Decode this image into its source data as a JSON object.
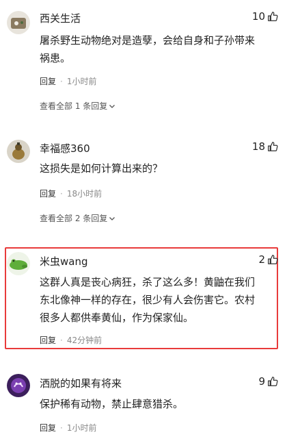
{
  "comments": [
    {
      "username": "西关生活",
      "likes": "10",
      "text": "屠杀野生动物绝对是造孽，会给自身和子孙带来\n祸患。",
      "reply_label": "回复",
      "time": "1小时前",
      "view_replies": "查看全部 1 条回复"
    },
    {
      "username": "幸福感360",
      "likes": "18",
      "text": "这损失是如何计算出来的？",
      "reply_label": "回复",
      "time": "18小时前",
      "view_replies": "查看全部 2 条回复"
    },
    {
      "username": "米虫wang",
      "likes": "2",
      "text": "这群人真是丧心病狂，杀了这么多！黄鼬在我们\n东北像神一样的存在，很少有人会伤害它。农村\n很多人都供奉黄仙，作为保家仙。",
      "reply_label": "回复",
      "time": "42分钟前"
    },
    {
      "username": "洒脱的如果有将来",
      "likes": "9",
      "text": "保护稀有动物，禁止肆意猎杀。",
      "reply_label": "回复",
      "time": "1小时前"
    }
  ],
  "colors": {
    "highlight": "#e83a3a",
    "meta": "#888888"
  },
  "icons": {
    "like": "thumb-up-icon",
    "expand": "chevron-down-icon"
  }
}
